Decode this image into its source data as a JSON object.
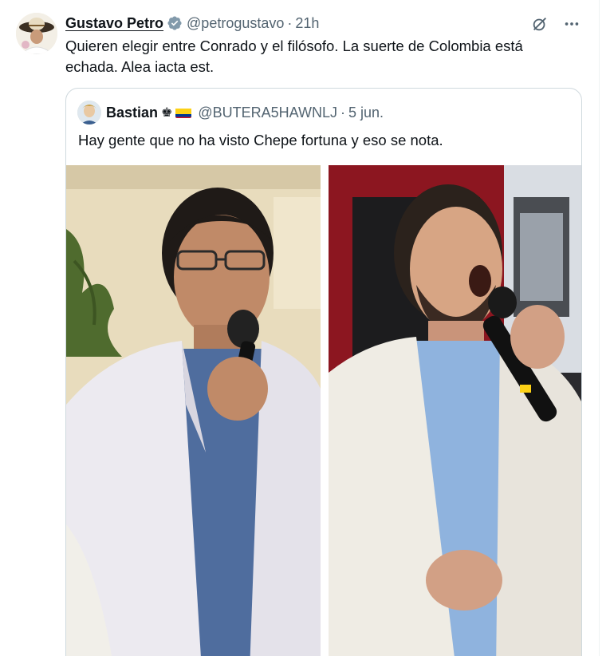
{
  "tweet": {
    "author_name": "Gustavo Petro",
    "author_handle": "@petrogustavo",
    "separator": "·",
    "time": "21h",
    "text": "Quieren elegir entre Conrado y el filósofo. La suerte de Colombia está echada. Alea iacta est.",
    "verified_icon": "verified-badge-icon",
    "grok_icon": "grok-icon",
    "more_icon": "more-options-icon"
  },
  "quote": {
    "author_name": "Bastian",
    "crown_glyph": "♚",
    "flag_icon": "colombia-flag-icon",
    "author_handle": "@BUTERA5HAWNLJ",
    "separator": "·",
    "date": "5 jun.",
    "text": "Hay gente que no ha visto Chepe fortuna y eso se nota.",
    "images": [
      {
        "icon": "photo-man-white-jacket-glasses"
      },
      {
        "icon": "photo-man-white-jacket-beard-microphone"
      }
    ]
  },
  "colors": {
    "text": "#0f1419",
    "secondary": "#536471",
    "verified": "#829aab",
    "border": "#cfd9de"
  }
}
